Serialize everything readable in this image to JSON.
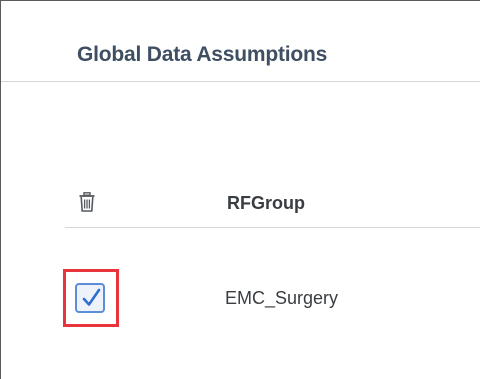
{
  "page": {
    "title": "Global Data Assumptions"
  },
  "table": {
    "delete_column_icon": "trash-icon",
    "columns": [
      "RFGroup"
    ],
    "rows": [
      {
        "selected": true,
        "rf_group": "EMC_Surgery"
      }
    ]
  },
  "colors": {
    "title": "#3f4f63",
    "highlight": "#e8343c",
    "checkbox_accent": "#5b8dd9"
  }
}
